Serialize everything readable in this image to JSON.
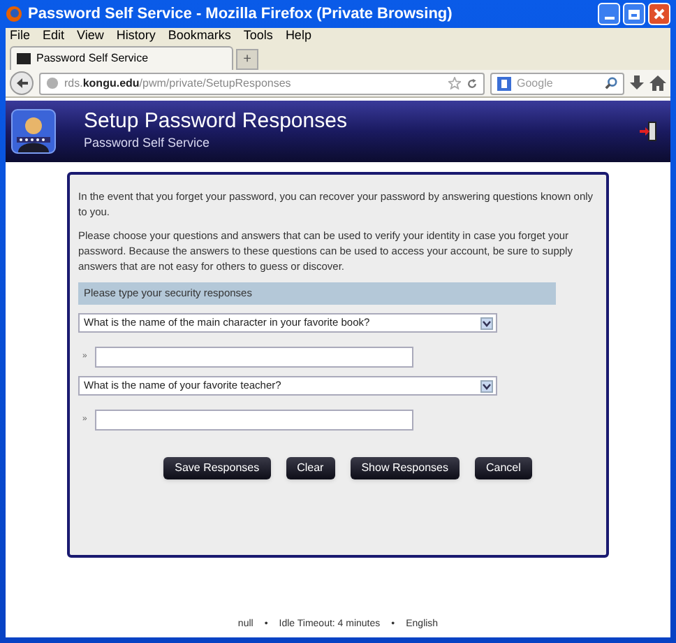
{
  "window": {
    "title": "Password Self Service - Mozilla Firefox (Private Browsing)"
  },
  "menu": [
    "File",
    "Edit",
    "View",
    "History",
    "Bookmarks",
    "Tools",
    "Help"
  ],
  "tabs": [
    {
      "label": "Password Self Service",
      "selected": true
    }
  ],
  "new_tab": "+",
  "address": "rds.**kongu.edu**/pwm/private/SetupResponses",
  "search": {
    "placeholder": "Google"
  },
  "header": {
    "title": "Setup Password Responses",
    "subtitle": "Password Self Service"
  },
  "intro": [
    "In the event that you forget your password, you can recover your password by answering questions known only to you.",
    "Please choose your questions and answers that can be used to verify your identity in case you forget your password. Because the answers to these questions can be used to access your account, be sure to supply answers that are not easy for others to guess or discover."
  ],
  "section": "Please type your security responses",
  "questions": [
    {
      "question": "What is the name of the main character in your favorite book?",
      "marker": "»"
    },
    {
      "question": "What is the name of your favorite teacher?",
      "marker": "»"
    }
  ],
  "buttons": [
    "Save Responses",
    "Clear",
    "Show Responses",
    "Cancel"
  ],
  "footer": [
    "null",
    "•",
    "Idle Timeout: 4 minutes",
    "•",
    "English"
  ]
}
